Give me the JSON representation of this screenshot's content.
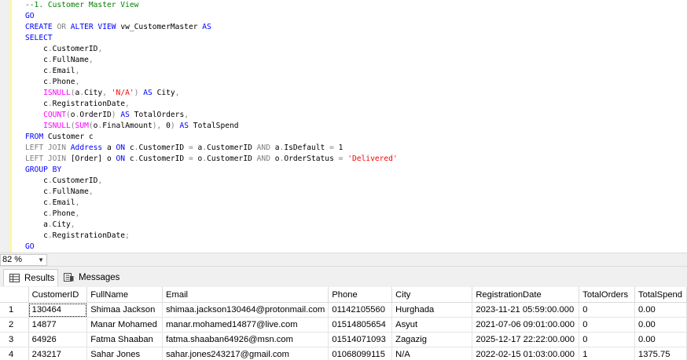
{
  "editor": {
    "lines": [
      [
        {
          "t": "--1. Customer Master View",
          "c": "cm"
        }
      ],
      [
        {
          "t": "GO",
          "c": "k"
        }
      ],
      [
        {
          "t": "CREATE",
          "c": "k"
        },
        {
          "t": " "
        },
        {
          "t": "OR",
          "c": "g"
        },
        {
          "t": " "
        },
        {
          "t": "ALTER VIEW",
          "c": "k"
        },
        {
          "t": " vw_CustomerMaster "
        },
        {
          "t": "AS",
          "c": "k"
        }
      ],
      [
        {
          "t": "SELECT",
          "c": "k"
        }
      ],
      [
        {
          "t": "    c"
        },
        {
          "t": ".",
          "c": "g"
        },
        {
          "t": "CustomerID"
        },
        {
          "t": ",",
          "c": "g"
        }
      ],
      [
        {
          "t": "    c"
        },
        {
          "t": ".",
          "c": "g"
        },
        {
          "t": "FullName"
        },
        {
          "t": ",",
          "c": "g"
        }
      ],
      [
        {
          "t": "    c"
        },
        {
          "t": ".",
          "c": "g"
        },
        {
          "t": "Email"
        },
        {
          "t": ",",
          "c": "g"
        }
      ],
      [
        {
          "t": "    c"
        },
        {
          "t": ".",
          "c": "g"
        },
        {
          "t": "Phone"
        },
        {
          "t": ",",
          "c": "g"
        }
      ],
      [
        {
          "t": "    "
        },
        {
          "t": "ISNULL",
          "c": "f"
        },
        {
          "t": "(",
          "c": "g"
        },
        {
          "t": "a"
        },
        {
          "t": ".",
          "c": "g"
        },
        {
          "t": "City"
        },
        {
          "t": ",",
          "c": "g"
        },
        {
          "t": " "
        },
        {
          "t": "'N/A'",
          "c": "s"
        },
        {
          "t": ")",
          "c": "g"
        },
        {
          "t": " "
        },
        {
          "t": "AS",
          "c": "k"
        },
        {
          "t": " City"
        },
        {
          "t": ",",
          "c": "g"
        }
      ],
      [
        {
          "t": "    c"
        },
        {
          "t": ".",
          "c": "g"
        },
        {
          "t": "RegistrationDate"
        },
        {
          "t": ",",
          "c": "g"
        }
      ],
      [
        {
          "t": "    "
        },
        {
          "t": "COUNT",
          "c": "f"
        },
        {
          "t": "(",
          "c": "g"
        },
        {
          "t": "o"
        },
        {
          "t": ".",
          "c": "g"
        },
        {
          "t": "OrderID"
        },
        {
          "t": ")",
          "c": "g"
        },
        {
          "t": " "
        },
        {
          "t": "AS",
          "c": "k"
        },
        {
          "t": " TotalOrders"
        },
        {
          "t": ",",
          "c": "g"
        }
      ],
      [
        {
          "t": "    "
        },
        {
          "t": "ISNULL",
          "c": "f"
        },
        {
          "t": "(",
          "c": "g"
        },
        {
          "t": "SUM",
          "c": "f"
        },
        {
          "t": "(",
          "c": "g"
        },
        {
          "t": "o"
        },
        {
          "t": ".",
          "c": "g"
        },
        {
          "t": "FinalAmount"
        },
        {
          "t": "),",
          "c": "g"
        },
        {
          "t": " 0"
        },
        {
          "t": ")",
          "c": "g"
        },
        {
          "t": " "
        },
        {
          "t": "AS",
          "c": "k"
        },
        {
          "t": " TotalSpend"
        }
      ],
      [
        {
          "t": "FROM",
          "c": "k"
        },
        {
          "t": " Customer c"
        }
      ],
      [
        {
          "t": "LEFT JOIN",
          "c": "g"
        },
        {
          "t": " "
        },
        {
          "t": "Address",
          "c": "k"
        },
        {
          "t": " a "
        },
        {
          "t": "ON",
          "c": "k"
        },
        {
          "t": " c"
        },
        {
          "t": ".",
          "c": "g"
        },
        {
          "t": "CustomerID "
        },
        {
          "t": "=",
          "c": "g"
        },
        {
          "t": " a"
        },
        {
          "t": ".",
          "c": "g"
        },
        {
          "t": "CustomerID "
        },
        {
          "t": "AND",
          "c": "g"
        },
        {
          "t": " a"
        },
        {
          "t": ".",
          "c": "g"
        },
        {
          "t": "IsDefault "
        },
        {
          "t": "=",
          "c": "g"
        },
        {
          "t": " 1"
        }
      ],
      [
        {
          "t": "LEFT JOIN",
          "c": "g"
        },
        {
          "t": " [Order] o "
        },
        {
          "t": "ON",
          "c": "k"
        },
        {
          "t": " c"
        },
        {
          "t": ".",
          "c": "g"
        },
        {
          "t": "CustomerID "
        },
        {
          "t": "=",
          "c": "g"
        },
        {
          "t": " o"
        },
        {
          "t": ".",
          "c": "g"
        },
        {
          "t": "CustomerID "
        },
        {
          "t": "AND",
          "c": "g"
        },
        {
          "t": " o"
        },
        {
          "t": ".",
          "c": "g"
        },
        {
          "t": "OrderStatus "
        },
        {
          "t": "=",
          "c": "g"
        },
        {
          "t": " "
        },
        {
          "t": "'Delivered'",
          "c": "s"
        }
      ],
      [
        {
          "t": "GROUP BY",
          "c": "k"
        }
      ],
      [
        {
          "t": "    c"
        },
        {
          "t": ".",
          "c": "g"
        },
        {
          "t": "CustomerID"
        },
        {
          "t": ",",
          "c": "g"
        }
      ],
      [
        {
          "t": "    c"
        },
        {
          "t": ".",
          "c": "g"
        },
        {
          "t": "FullName"
        },
        {
          "t": ",",
          "c": "g"
        }
      ],
      [
        {
          "t": "    c"
        },
        {
          "t": ".",
          "c": "g"
        },
        {
          "t": "Email"
        },
        {
          "t": ",",
          "c": "g"
        }
      ],
      [
        {
          "t": "    c"
        },
        {
          "t": ".",
          "c": "g"
        },
        {
          "t": "Phone"
        },
        {
          "t": ",",
          "c": "g"
        }
      ],
      [
        {
          "t": "    a"
        },
        {
          "t": ".",
          "c": "g"
        },
        {
          "t": "City"
        },
        {
          "t": ",",
          "c": "g"
        }
      ],
      [
        {
          "t": "    c"
        },
        {
          "t": ".",
          "c": "g"
        },
        {
          "t": "RegistrationDate"
        },
        {
          "t": ";",
          "c": "g"
        }
      ],
      [
        {
          "t": "GO",
          "c": "k"
        }
      ]
    ]
  },
  "zoom": {
    "value": "82 %"
  },
  "tabs": [
    {
      "label": "Results",
      "icon": "grid-icon",
      "active": true
    },
    {
      "label": "Messages",
      "icon": "messages-icon",
      "active": false
    }
  ],
  "results": {
    "columns": [
      "CustomerID",
      "FullName",
      "Email",
      "Phone",
      "City",
      "RegistrationDate",
      "TotalOrders",
      "TotalSpend"
    ],
    "rows": [
      {
        "n": "1",
        "cells": [
          "130464",
          "Shimaa Jackson",
          "shimaa.jackson130464@protonmail.com",
          "01142105560",
          "Hurghada",
          "2023-11-21 05:59:00.000",
          "0",
          "0.00"
        ]
      },
      {
        "n": "2",
        "cells": [
          "14877",
          "Manar Mohamed",
          "manar.mohamed14877@live.com",
          "01514805654",
          "Asyut",
          "2021-07-06 09:01:00.000",
          "0",
          "0.00"
        ]
      },
      {
        "n": "3",
        "cells": [
          "64926",
          "Fatma Shaaban",
          "fatma.shaaban64926@msn.com",
          "01514071093",
          "Zagazig",
          "2025-12-17 22:22:00.000",
          "0",
          "0.00"
        ]
      },
      {
        "n": "4",
        "cells": [
          "243217",
          "Sahar Jones",
          "sahar.jones243217@gmail.com",
          "01068099115",
          "N/A",
          "2022-02-15 01:03:00.000",
          "1",
          "1375.75"
        ]
      }
    ]
  },
  "colors": {
    "keyword": "#0000ff",
    "function": "#ff00ff",
    "string": "#ff0000",
    "comment": "#008000",
    "operator": "#808080"
  }
}
